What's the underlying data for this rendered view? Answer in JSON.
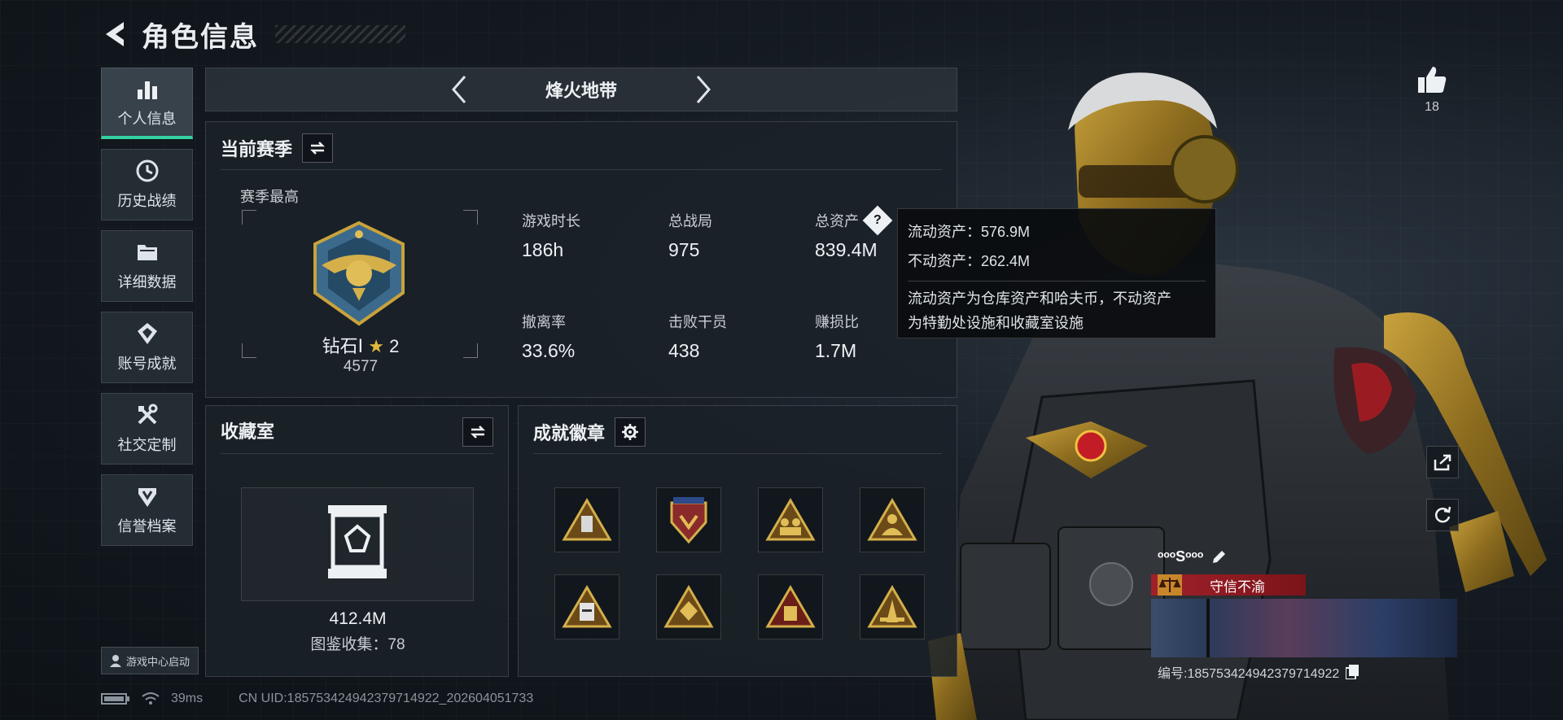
{
  "header": {
    "title": "角色信息"
  },
  "sidebar": {
    "items": [
      {
        "label": "个人信息",
        "icon": "bar-chart-icon",
        "active": true
      },
      {
        "label": "历史战绩",
        "icon": "clock-icon"
      },
      {
        "label": "详细数据",
        "icon": "folder-icon"
      },
      {
        "label": "账号成就",
        "icon": "trophy-icon"
      },
      {
        "label": "社交定制",
        "icon": "tools-icon"
      },
      {
        "label": "信誉档案",
        "icon": "shield-icon"
      }
    ],
    "game_center": "游戏中心启动"
  },
  "status_bar": {
    "ping": "39ms",
    "uid": "CN UID:185753424942379714922_202604051733"
  },
  "mode_selector": {
    "name": "烽火地带"
  },
  "season": {
    "title": "当前赛季",
    "best_label": "赛季最高",
    "rank": "钻石Ⅰ",
    "rank_stars": "2",
    "rank_score": "4577",
    "stats": [
      {
        "label": "游戏时长",
        "value": "186h"
      },
      {
        "label": "总战局",
        "value": "975"
      },
      {
        "label": "总资产",
        "value": "839.4M"
      },
      {
        "label": "撤离率",
        "value": "33.6%"
      },
      {
        "label": "击败干员",
        "value": "438"
      },
      {
        "label": "赚损比",
        "value": "1.7M"
      }
    ]
  },
  "tooltip": {
    "liquid": "流动资产：576.9M",
    "fixed": "不动资产：262.4M",
    "note_line1": "流动资产为仓库资产和哈夫币，不动资产",
    "note_line2": "为特勤处设施和收藏室设施"
  },
  "collection": {
    "title": "收藏室",
    "value": "412.4M",
    "count": "图鉴收集：78"
  },
  "badges": {
    "title": "成就徽章",
    "count": 8
  },
  "likes": {
    "count": "18"
  },
  "player_card": {
    "name": "ᵒᵒᵒSᵒᵒᵒ",
    "title": "守信不渝",
    "id": "编号:185753424942379714922"
  },
  "colors": {
    "accent": "#33d1a1",
    "gold": "#e2b73e",
    "title_red": "#a1202a"
  }
}
